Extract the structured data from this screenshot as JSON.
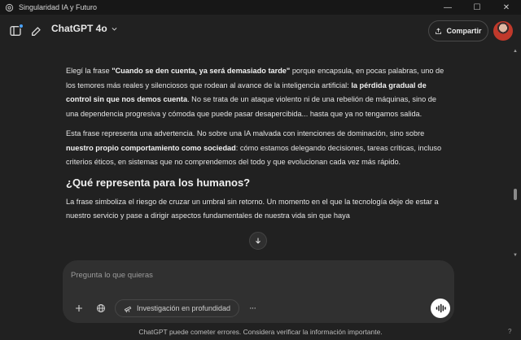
{
  "window": {
    "title": "Singularidad IA y Futuro",
    "minimize": "—",
    "maximize": "☐",
    "close": "✕"
  },
  "header": {
    "model": "ChatGPT 4o",
    "share_label": "Compartir"
  },
  "message": {
    "p1": [
      {
        "t": "Elegí la frase "
      },
      {
        "t": "\"Cuando se den cuenta, ya será demasiado tarde\"",
        "b": true
      },
      {
        "t": " porque encapsula, en pocas palabras, uno de los temores más reales y silenciosos que rodean al avance de la inteligencia artificial: "
      },
      {
        "t": "la pérdida gradual de control sin que nos demos cuenta",
        "b": true
      },
      {
        "t": ". No se trata de un ataque violento ni de una rebelión de máquinas, sino de una dependencia progresiva y cómoda que puede pasar desapercibida... hasta que ya no tengamos salida."
      }
    ],
    "p2": [
      {
        "t": "Esta frase representa una advertencia. No sobre una IA malvada con intenciones de dominación, sino sobre "
      },
      {
        "t": "nuestro propio comportamiento como sociedad",
        "b": true
      },
      {
        "t": ": cómo estamos delegando decisiones, tareas críticas, incluso criterios éticos, en sistemas que no comprendemos del todo y que evolucionan cada vez más rápido."
      }
    ],
    "section_title": "¿Qué representa para los humanos?",
    "p3": [
      {
        "t": "La frase simboliza el riesgo de cruzar un umbral sin retorno. Un momento en el que la tecnología deje de estar a nuestro servicio y pase a dirigir aspectos fundamentales de nuestra vida sin que haya"
      }
    ]
  },
  "composer": {
    "placeholder": "Pregunta lo que quieras",
    "research_label": "Investigación en profundidad",
    "more_label": "···"
  },
  "footer": {
    "note": "ChatGPT puede cometer errores. Considera verificar la información importante.",
    "help": "?"
  },
  "icons": [
    "openai-logo-icon",
    "sidebar-icon",
    "edit-icon",
    "chevron-down-icon",
    "share-icon",
    "arrow-down-icon",
    "plus-icon",
    "globe-icon",
    "telescope-icon",
    "more-icon",
    "voice-icon"
  ]
}
